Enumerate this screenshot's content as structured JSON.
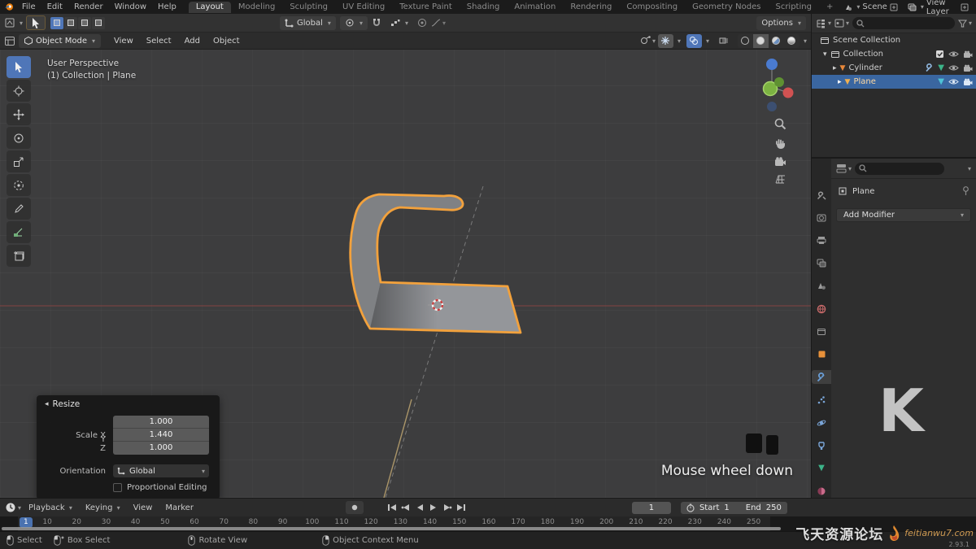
{
  "colors": {
    "accent_orange": "#e87d0d",
    "selection_blue": "#3a66a0",
    "active_tool_blue": "#4f76b8",
    "object_outline": "#f2a13c",
    "axis_red": "#8a4444"
  },
  "topbar": {
    "menus": [
      "File",
      "Edit",
      "Render",
      "Window",
      "Help"
    ],
    "workspaces": [
      "Layout",
      "Modeling",
      "Sculpting",
      "UV Editing",
      "Texture Paint",
      "Shading",
      "Animation",
      "Rendering",
      "Compositing",
      "Geometry Nodes",
      "Scripting",
      "+"
    ],
    "active_workspace": "Layout",
    "scene_label": "Scene",
    "view_layer_label": "View Layer"
  },
  "tool_settings": {
    "orientation": "Global",
    "options_label": "Options"
  },
  "viewport_header": {
    "mode": "Object Mode",
    "menus": [
      "View",
      "Select",
      "Add",
      "Object"
    ]
  },
  "viewport": {
    "overlay_line1": "User Perspective",
    "overlay_line2": "(1) Collection | Plane",
    "screencast_text": "Mouse wheel down",
    "toolbar_icons": [
      "select-box",
      "cursor",
      "move",
      "rotate",
      "scale",
      "transform",
      "annotate",
      "measure",
      "add-cube"
    ],
    "nav_icons": [
      "zoom",
      "pan-hand",
      "camera-view",
      "toggle-ortho"
    ]
  },
  "resize_panel": {
    "title": "Resize",
    "fields": [
      {
        "label": "Scale X",
        "value": "1.000"
      },
      {
        "label": "Y",
        "value": "1.440"
      },
      {
        "label": "Z",
        "value": "1.000"
      }
    ],
    "orientation_label": "Orientation",
    "orientation_value": "Global",
    "checkbox_label": "Proportional Editing"
  },
  "outliner": {
    "root": "Scene Collection",
    "collection": "Collection",
    "cylinder": "Cylinder",
    "plane": "Plane"
  },
  "properties": {
    "object_name": "Plane",
    "add_modifier_label": "Add Modifier",
    "watermark_letter": "K",
    "tabs": [
      "tool",
      "render",
      "output",
      "view-layer",
      "scene",
      "world",
      "collection",
      "object",
      "modifiers",
      "particles",
      "physics",
      "constraints",
      "object-data",
      "material"
    ],
    "active_tab": "modifiers"
  },
  "timeline": {
    "menus": [
      "Playback",
      "Keying",
      "View",
      "Marker"
    ],
    "current_frame": "1",
    "start_label": "Start",
    "start_value": "1",
    "end_label": "End",
    "end_value": "250",
    "ticks": [
      "10",
      "20",
      "30",
      "40",
      "50",
      "60",
      "70",
      "80",
      "90",
      "100",
      "110",
      "120",
      "130",
      "140",
      "150",
      "160",
      "170",
      "180",
      "190",
      "200",
      "210",
      "220",
      "230",
      "240",
      "250"
    ]
  },
  "statusbar": {
    "hints": [
      "Select",
      "Box Select",
      "Rotate View",
      "Object Context Menu"
    ]
  },
  "watermark": {
    "cn": "飞天资源论坛",
    "url": "feitianwu7.com",
    "version": "2.93.1"
  }
}
